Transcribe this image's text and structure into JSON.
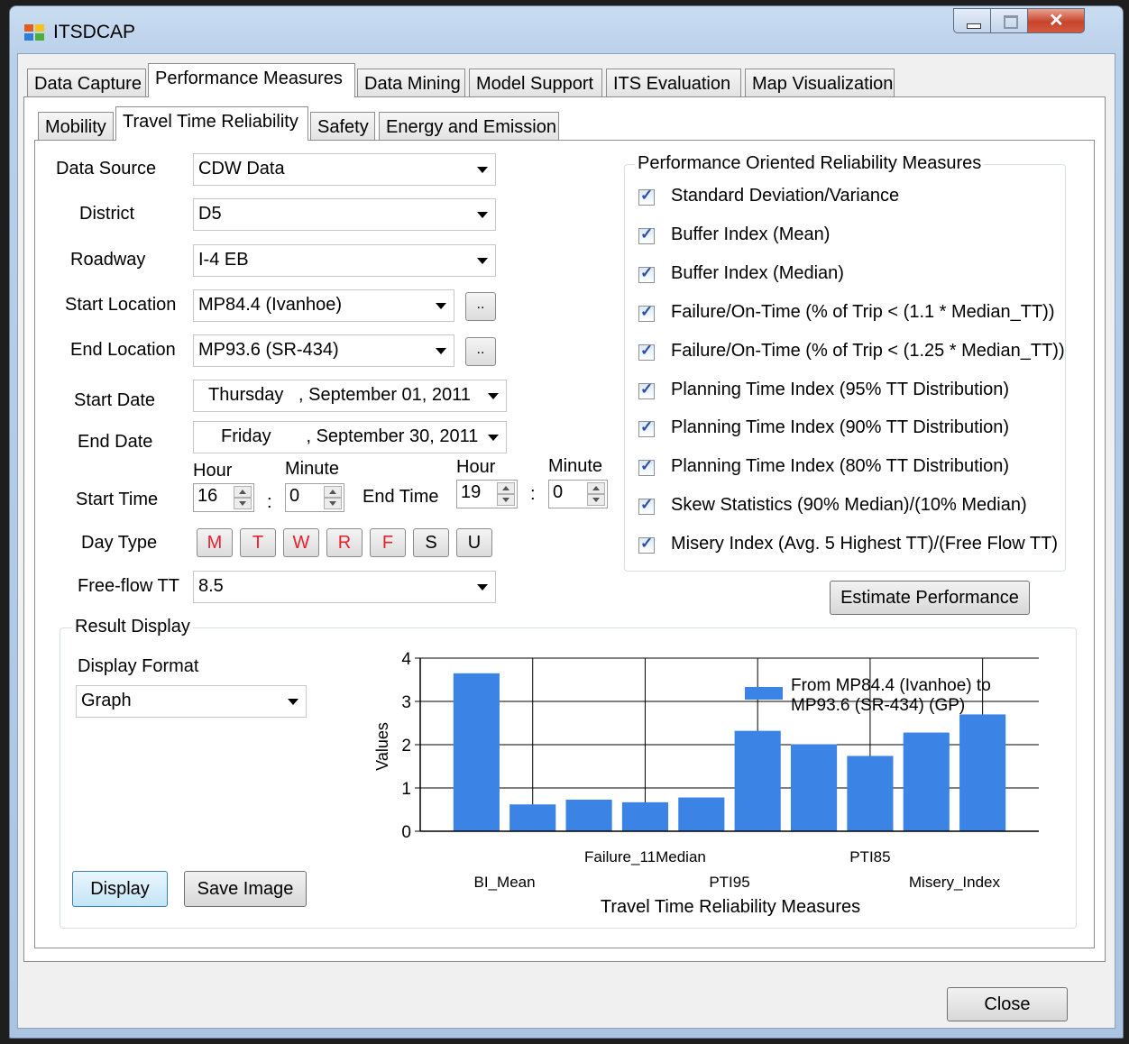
{
  "window": {
    "title": "ITSDCAP"
  },
  "main_tabs": [
    "Data Capture",
    "Performance Measures",
    "Data Mining",
    "Model Support",
    "ITS Evaluation",
    "Map Visualization"
  ],
  "sub_tabs": [
    "Mobility",
    "Travel Time Reliability",
    "Safety",
    "Energy and Emission"
  ],
  "form": {
    "data_source_label": "Data Source",
    "data_source": "CDW Data",
    "district_label": "District",
    "district": "D5",
    "roadway_label": "Roadway",
    "roadway": "I-4 EB",
    "start_location_label": "Start Location",
    "start_location": "MP84.4 (Ivanhoe)",
    "end_location_label": "End Location",
    "end_location": "MP93.6 (SR-434)",
    "browse_label": "..",
    "start_date_label": "Start Date",
    "start_date": "Thursday   , September 01, 2011",
    "end_date_label": "End Date",
    "end_date": "Friday       , September 30, 2011",
    "hour_label": "Hour",
    "minute_label": "Minute",
    "start_time_label": "Start Time",
    "start_hour": "16",
    "start_minute": "0",
    "end_time_label": "End Time",
    "end_hour": "19",
    "end_minute": "0",
    "colon": ":",
    "day_type_label": "Day Type",
    "days": [
      "M",
      "T",
      "W",
      "R",
      "F",
      "S",
      "U"
    ],
    "freeflow_label": "Free-flow TT",
    "freeflow": "8.5"
  },
  "measures": {
    "title": "Performance Oriented Reliability Measures",
    "items": [
      "Standard Deviation/Variance",
      "Buffer Index (Mean)",
      "Buffer Index (Median)",
      "Failure/On-Time (% of Trip < (1.1 * Median_TT))",
      "Failure/On-Time (% of Trip < (1.25 * Median_TT))",
      "Planning Time Index (95% TT Distribution)",
      "Planning Time Index (90% TT Distribution)",
      "Planning Time Index (80% TT Distribution)",
      "Skew Statistics (90% Median)/(10% Median)",
      "Misery Index (Avg. 5 Highest TT)/(Free Flow TT)"
    ],
    "estimate_button": "Estimate Performance"
  },
  "result": {
    "title": "Result Display",
    "format_label": "Display Format",
    "format": "Graph",
    "display_button": "Display",
    "save_button": "Save Image"
  },
  "close_button": "Close",
  "colors": {
    "bar": "#3b84e6",
    "red_day": "#e8202c"
  },
  "chart_data": {
    "type": "bar",
    "ylabel": "Values",
    "xlabel": "Travel Time Reliability Measures",
    "ylim": [
      0,
      4
    ],
    "yticks": [
      "0",
      "1",
      "2",
      "3",
      "4"
    ],
    "tick_labels_lower": [
      "BI_Mean",
      "PTI95",
      "Misery_Index"
    ],
    "tick_labels_upper": [
      "Failure_11Median",
      "PTI85"
    ],
    "series": [
      {
        "name": "From MP84.4 (Ivanhoe) to MP93.6 (SR-434) (GP)",
        "values": [
          3.65,
          0.62,
          0.73,
          0.67,
          0.78,
          2.32,
          2.01,
          1.74,
          2.28,
          2.7
        ]
      }
    ],
    "legend_lines": [
      "From MP84.4 (Ivanhoe) to",
      "MP93.6 (SR-434) (GP)"
    ],
    "legend_position": "top-right",
    "grid": true
  }
}
